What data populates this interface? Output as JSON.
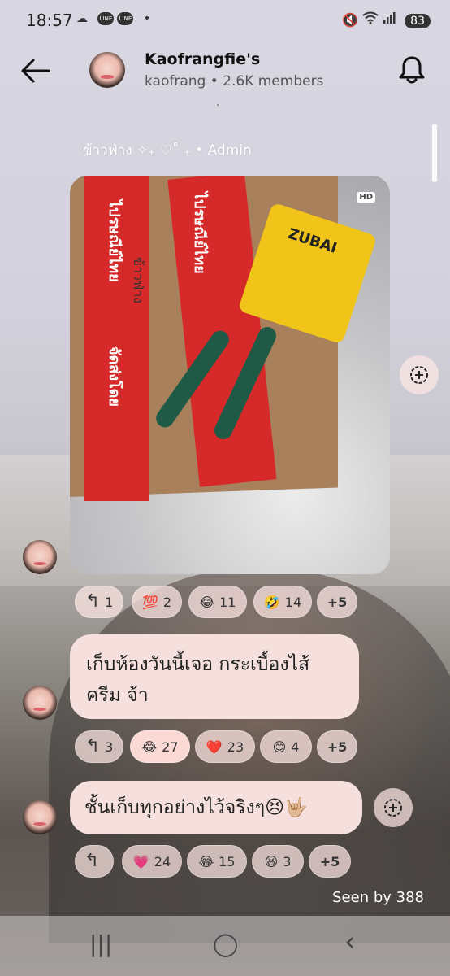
{
  "status_bar": {
    "time": "18:57",
    "line_badge": "LINE",
    "more_dot": "•",
    "battery": "83"
  },
  "header": {
    "title": "Kaofrangfie's",
    "subtitle": "kaofrang • 2.6K members"
  },
  "feed": {
    "separator_dot": "·",
    "sender_label": "ข้าวฟ่าง ✧₊ ♡˚ ₊ • Admin",
    "photo_badge": "HD",
    "photo_tape_text_1": "ไปรษณีย์ไทย",
    "photo_tape_text_2": "จัดส่งโดย",
    "photo_card_brand": "ZUBAI",
    "photo_handwriting": "ข้าวฟ่าง"
  },
  "messages": [
    {
      "type": "image",
      "reactions": [
        {
          "emoji": "",
          "count": "1",
          "kind": "reply"
        },
        {
          "emoji": "💯",
          "count": "2"
        },
        {
          "emoji": "😂",
          "count": "11"
        },
        {
          "emoji": "🤣",
          "count": "14"
        },
        {
          "emoji": "",
          "count": "+5",
          "kind": "more"
        }
      ]
    },
    {
      "type": "text",
      "text": "เก็บห้องวันนี้เจอ กระเบื้องไส้ ครีม จ้า",
      "reactions": [
        {
          "emoji": "",
          "count": "3",
          "kind": "reply"
        },
        {
          "emoji": "😂",
          "count": "27"
        },
        {
          "emoji": "❤️",
          "count": "23"
        },
        {
          "emoji": "😊",
          "count": "4"
        },
        {
          "emoji": "",
          "count": "+5",
          "kind": "more"
        }
      ]
    },
    {
      "type": "text",
      "text": "ชั้นเก็บทุกอย่างไว้จริงๆ😣🤟🏼",
      "reactions": [
        {
          "emoji": "",
          "count": "",
          "kind": "reply"
        },
        {
          "emoji": "💗",
          "count": "24"
        },
        {
          "emoji": "😂",
          "count": "15"
        },
        {
          "emoji": "😆",
          "count": "3"
        },
        {
          "emoji": "",
          "count": "+5",
          "kind": "more"
        }
      ]
    }
  ],
  "seen_text": "Seen by 388",
  "icons": {
    "back": "arrow-left",
    "bell": "bell",
    "add_reaction": "add-reaction",
    "reply": "reply-arrow",
    "nav_recent": "recents",
    "nav_home": "home",
    "nav_back": "back"
  },
  "nav": {
    "recent": "|||",
    "home": "◯",
    "back": "‹"
  }
}
